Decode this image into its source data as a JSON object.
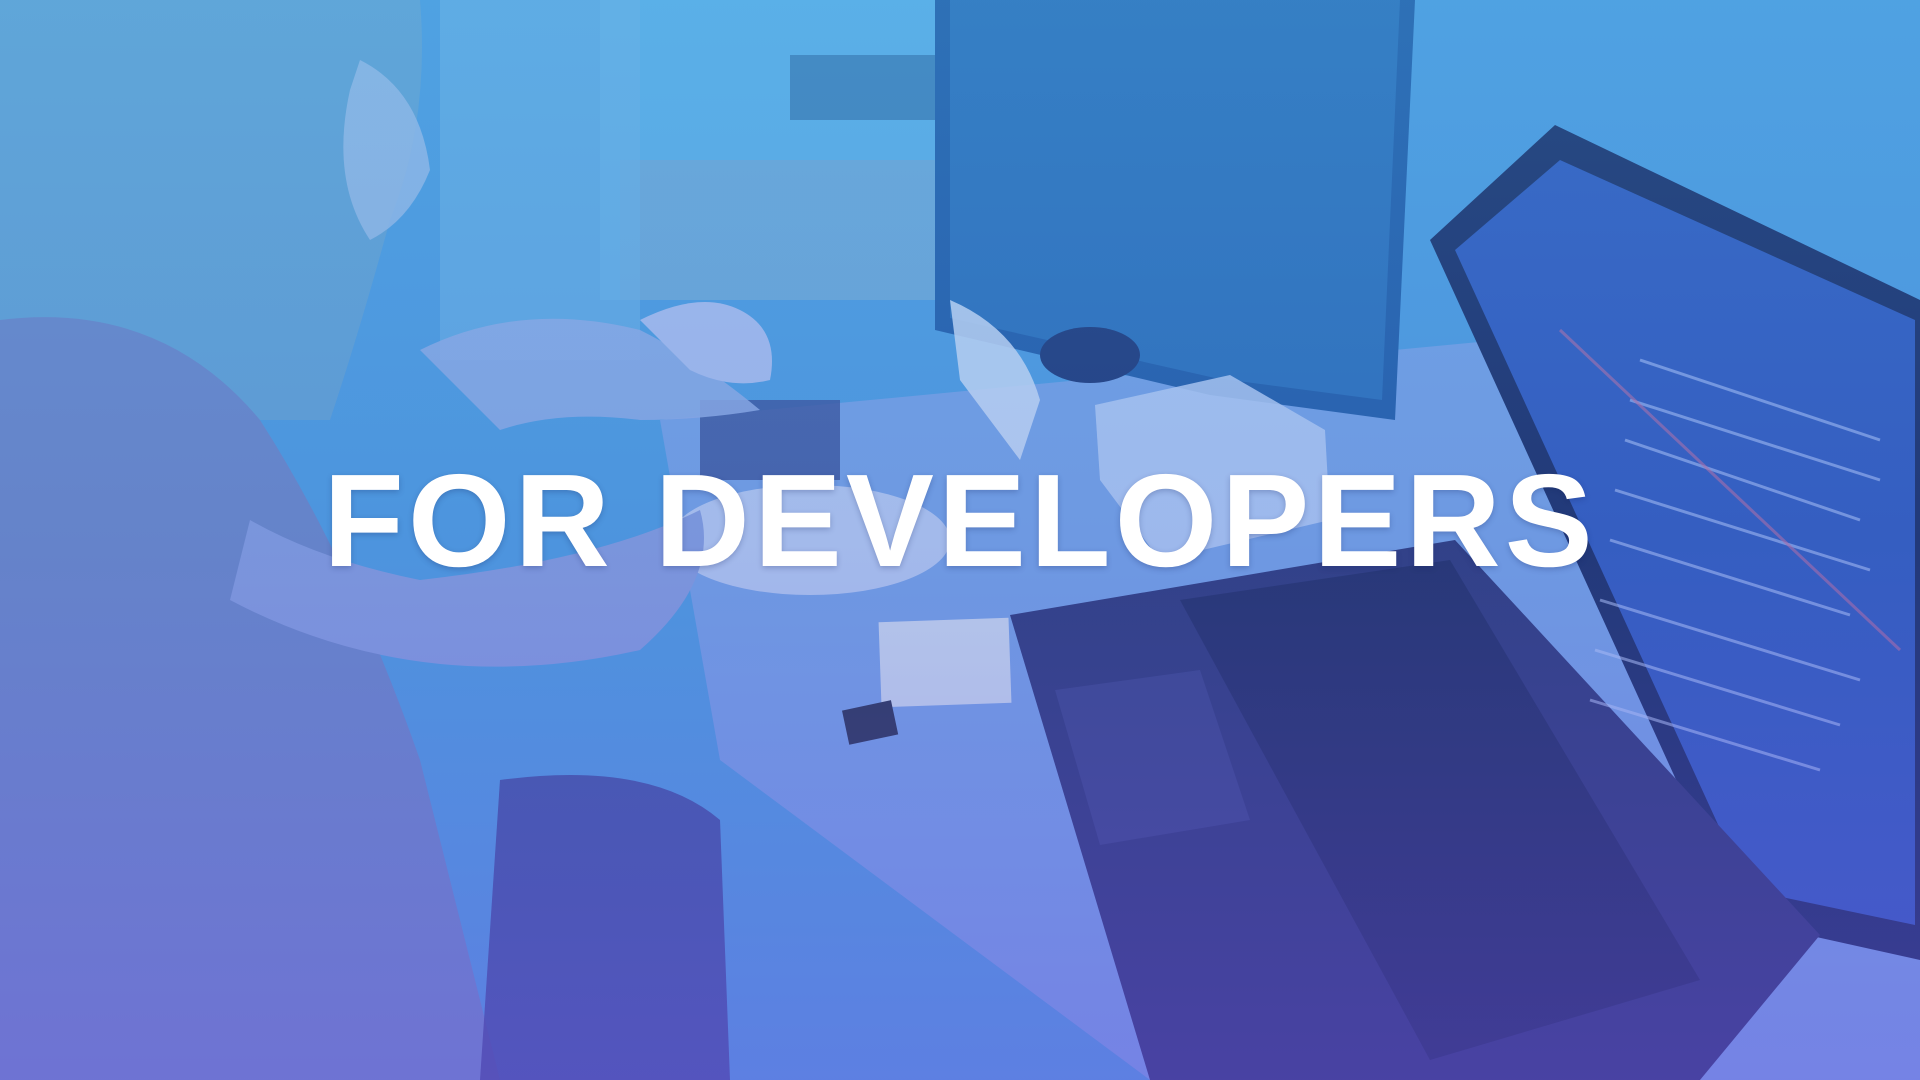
{
  "hero": {
    "headline": "FOR DEVELOPERS"
  },
  "colors": {
    "tint_top": "#4fa6e0",
    "tint_mid": "#4a7fd6",
    "tint_bottom": "#6a50d6",
    "headline": "#ffffff"
  }
}
